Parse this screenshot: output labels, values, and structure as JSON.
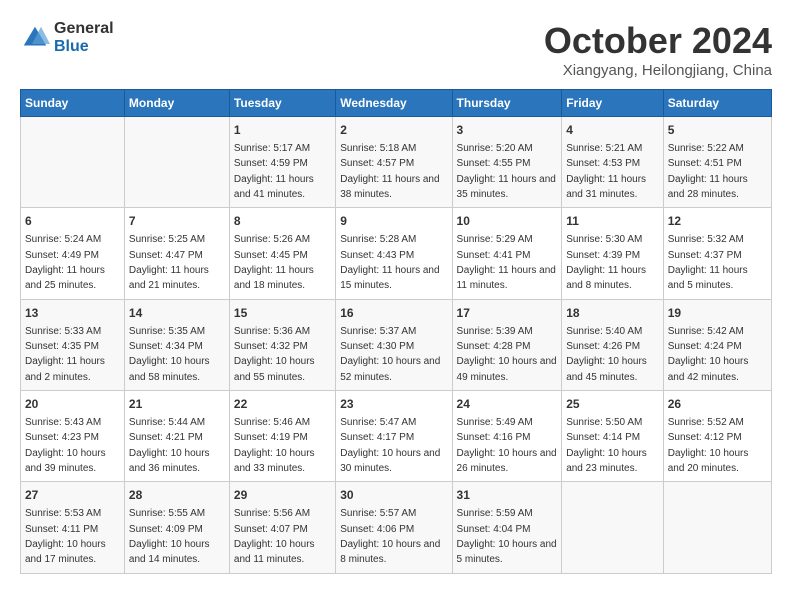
{
  "logo": {
    "general": "General",
    "blue": "Blue"
  },
  "title": "October 2024",
  "subtitle": "Xiangyang, Heilongjiang, China",
  "days_of_week": [
    "Sunday",
    "Monday",
    "Tuesday",
    "Wednesday",
    "Thursday",
    "Friday",
    "Saturday"
  ],
  "weeks": [
    [
      {
        "day": "",
        "info": ""
      },
      {
        "day": "",
        "info": ""
      },
      {
        "day": "1",
        "info": "Sunrise: 5:17 AM\nSunset: 4:59 PM\nDaylight: 11 hours and 41 minutes."
      },
      {
        "day": "2",
        "info": "Sunrise: 5:18 AM\nSunset: 4:57 PM\nDaylight: 11 hours and 38 minutes."
      },
      {
        "day": "3",
        "info": "Sunrise: 5:20 AM\nSunset: 4:55 PM\nDaylight: 11 hours and 35 minutes."
      },
      {
        "day": "4",
        "info": "Sunrise: 5:21 AM\nSunset: 4:53 PM\nDaylight: 11 hours and 31 minutes."
      },
      {
        "day": "5",
        "info": "Sunrise: 5:22 AM\nSunset: 4:51 PM\nDaylight: 11 hours and 28 minutes."
      }
    ],
    [
      {
        "day": "6",
        "info": "Sunrise: 5:24 AM\nSunset: 4:49 PM\nDaylight: 11 hours and 25 minutes."
      },
      {
        "day": "7",
        "info": "Sunrise: 5:25 AM\nSunset: 4:47 PM\nDaylight: 11 hours and 21 minutes."
      },
      {
        "day": "8",
        "info": "Sunrise: 5:26 AM\nSunset: 4:45 PM\nDaylight: 11 hours and 18 minutes."
      },
      {
        "day": "9",
        "info": "Sunrise: 5:28 AM\nSunset: 4:43 PM\nDaylight: 11 hours and 15 minutes."
      },
      {
        "day": "10",
        "info": "Sunrise: 5:29 AM\nSunset: 4:41 PM\nDaylight: 11 hours and 11 minutes."
      },
      {
        "day": "11",
        "info": "Sunrise: 5:30 AM\nSunset: 4:39 PM\nDaylight: 11 hours and 8 minutes."
      },
      {
        "day": "12",
        "info": "Sunrise: 5:32 AM\nSunset: 4:37 PM\nDaylight: 11 hours and 5 minutes."
      }
    ],
    [
      {
        "day": "13",
        "info": "Sunrise: 5:33 AM\nSunset: 4:35 PM\nDaylight: 11 hours and 2 minutes."
      },
      {
        "day": "14",
        "info": "Sunrise: 5:35 AM\nSunset: 4:34 PM\nDaylight: 10 hours and 58 minutes."
      },
      {
        "day": "15",
        "info": "Sunrise: 5:36 AM\nSunset: 4:32 PM\nDaylight: 10 hours and 55 minutes."
      },
      {
        "day": "16",
        "info": "Sunrise: 5:37 AM\nSunset: 4:30 PM\nDaylight: 10 hours and 52 minutes."
      },
      {
        "day": "17",
        "info": "Sunrise: 5:39 AM\nSunset: 4:28 PM\nDaylight: 10 hours and 49 minutes."
      },
      {
        "day": "18",
        "info": "Sunrise: 5:40 AM\nSunset: 4:26 PM\nDaylight: 10 hours and 45 minutes."
      },
      {
        "day": "19",
        "info": "Sunrise: 5:42 AM\nSunset: 4:24 PM\nDaylight: 10 hours and 42 minutes."
      }
    ],
    [
      {
        "day": "20",
        "info": "Sunrise: 5:43 AM\nSunset: 4:23 PM\nDaylight: 10 hours and 39 minutes."
      },
      {
        "day": "21",
        "info": "Sunrise: 5:44 AM\nSunset: 4:21 PM\nDaylight: 10 hours and 36 minutes."
      },
      {
        "day": "22",
        "info": "Sunrise: 5:46 AM\nSunset: 4:19 PM\nDaylight: 10 hours and 33 minutes."
      },
      {
        "day": "23",
        "info": "Sunrise: 5:47 AM\nSunset: 4:17 PM\nDaylight: 10 hours and 30 minutes."
      },
      {
        "day": "24",
        "info": "Sunrise: 5:49 AM\nSunset: 4:16 PM\nDaylight: 10 hours and 26 minutes."
      },
      {
        "day": "25",
        "info": "Sunrise: 5:50 AM\nSunset: 4:14 PM\nDaylight: 10 hours and 23 minutes."
      },
      {
        "day": "26",
        "info": "Sunrise: 5:52 AM\nSunset: 4:12 PM\nDaylight: 10 hours and 20 minutes."
      }
    ],
    [
      {
        "day": "27",
        "info": "Sunrise: 5:53 AM\nSunset: 4:11 PM\nDaylight: 10 hours and 17 minutes."
      },
      {
        "day": "28",
        "info": "Sunrise: 5:55 AM\nSunset: 4:09 PM\nDaylight: 10 hours and 14 minutes."
      },
      {
        "day": "29",
        "info": "Sunrise: 5:56 AM\nSunset: 4:07 PM\nDaylight: 10 hours and 11 minutes."
      },
      {
        "day": "30",
        "info": "Sunrise: 5:57 AM\nSunset: 4:06 PM\nDaylight: 10 hours and 8 minutes."
      },
      {
        "day": "31",
        "info": "Sunrise: 5:59 AM\nSunset: 4:04 PM\nDaylight: 10 hours and 5 minutes."
      },
      {
        "day": "",
        "info": ""
      },
      {
        "day": "",
        "info": ""
      }
    ]
  ]
}
